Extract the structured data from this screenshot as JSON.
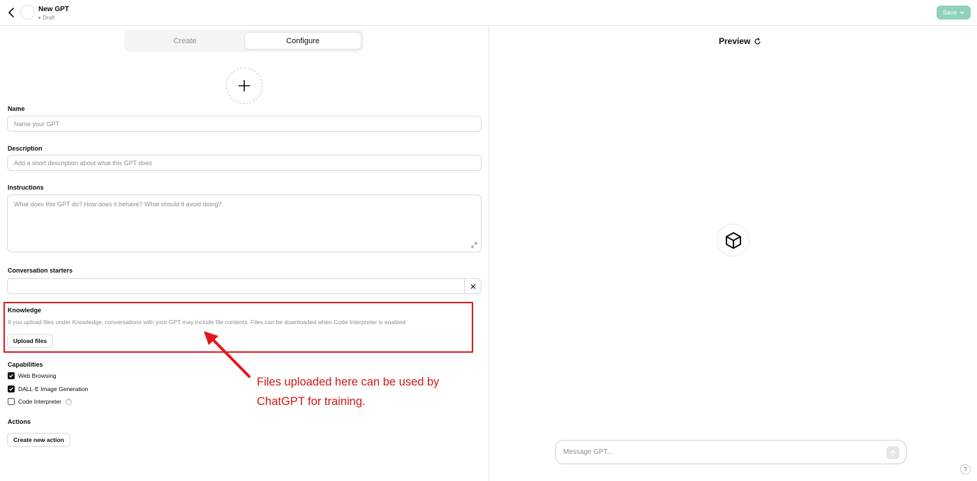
{
  "header": {
    "title": "New GPT",
    "status": "Draft",
    "save_label": "Save"
  },
  "tabs": [
    {
      "label": "Create",
      "active": false
    },
    {
      "label": "Configure",
      "active": true
    }
  ],
  "form": {
    "name": {
      "label": "Name",
      "placeholder": "Name your GPT"
    },
    "description": {
      "label": "Description",
      "placeholder": "Add a short description about what this GPT does"
    },
    "instructions": {
      "label": "Instructions",
      "placeholder": "What does this GPT do? How does it behave? What should it avoid doing?"
    },
    "starters": {
      "label": "Conversation starters",
      "value": ""
    },
    "knowledge": {
      "label": "Knowledge",
      "hint": "If you upload files under Knowledge, conversations with your GPT may include file contents. Files can be downloaded when Code Interpreter is enabled",
      "upload_label": "Upload files"
    },
    "capabilities": {
      "label": "Capabilities",
      "items": [
        {
          "label": "Web Browsing",
          "checked": true
        },
        {
          "label": "DALL·E Image Generation",
          "checked": true
        },
        {
          "label": "Code Interpreter",
          "checked": false
        }
      ]
    },
    "actions": {
      "label": "Actions",
      "button_label": "Create new action"
    }
  },
  "annotation": {
    "text": "Files uploaded here can be used by ChatGPT for training.",
    "color": "#d31616"
  },
  "preview": {
    "title": "Preview",
    "message_placeholder": "Message GPT..."
  },
  "help_label": "?",
  "colors": {
    "save_button": "#8fd1b9",
    "highlight_border": "#e3161b"
  }
}
